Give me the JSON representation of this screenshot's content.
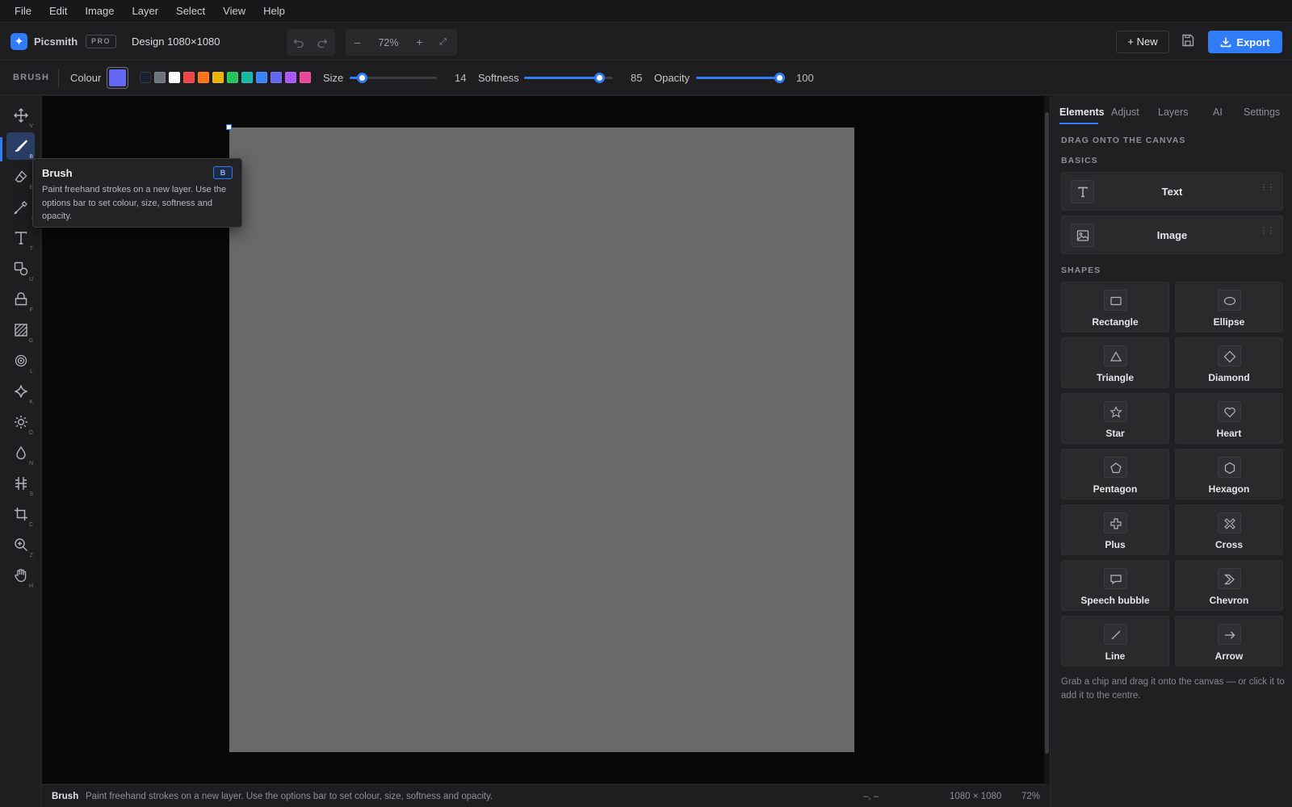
{
  "menu": [
    "File",
    "Edit",
    "Image",
    "Layer",
    "Select",
    "View",
    "Help"
  ],
  "app": {
    "name": "Picsmith",
    "badge": "PRO",
    "document": "Design 1080×1080"
  },
  "history": {
    "undo_icon": "undo-icon",
    "redo_icon": "redo-icon"
  },
  "zoom": {
    "minus": "–",
    "value": "72%",
    "plus": "+",
    "fit": "⤢"
  },
  "actions": {
    "new_label": "+ New",
    "save_icon": "save-icon",
    "export_label": "Export"
  },
  "options": {
    "tool": "BRUSH",
    "colour_label": "Colour",
    "current_colour": "#6467f2",
    "swatches": [
      "#1b2030",
      "#6b7280",
      "#ffffff",
      "#ef4444",
      "#f97316",
      "#eab308",
      "#22c55e",
      "#14b8a6",
      "#3b82f6",
      "#6366f1",
      "#a855f7",
      "#ec4899"
    ],
    "size": {
      "label": "Size",
      "value": "14",
      "fraction": 0.14
    },
    "softness": {
      "label": "Softness",
      "value": "85",
      "fraction": 0.85
    },
    "opacity": {
      "label": "Opacity",
      "value": "100",
      "fraction": 1.0
    },
    "accent": "#2f7cf6"
  },
  "tools": [
    {
      "name": "move-icon",
      "key": "V"
    },
    {
      "name": "brush-icon",
      "key": "B",
      "active": true
    },
    {
      "name": "eraser-icon",
      "key": "E"
    },
    {
      "name": "eyedropper-icon",
      "key": "I"
    },
    {
      "name": "text-icon",
      "key": "T"
    },
    {
      "name": "shapes-icon",
      "key": "U"
    },
    {
      "name": "fill-icon",
      "key": "F"
    },
    {
      "name": "gradient-icon",
      "key": "G"
    },
    {
      "name": "blur-icon",
      "key": "L"
    },
    {
      "name": "sparkle-icon",
      "key": "K"
    },
    {
      "name": "dodge-icon",
      "key": "O"
    },
    {
      "name": "smudge-icon",
      "key": "N"
    },
    {
      "name": "sharpen-icon",
      "key": "S"
    },
    {
      "name": "crop-icon",
      "key": "C"
    },
    {
      "name": "zoom-icon",
      "key": "Z"
    },
    {
      "name": "hand-icon",
      "key": "H"
    }
  ],
  "tooltip": {
    "title": "Brush",
    "key": "B",
    "description": "Paint freehand strokes on a new layer. Use the options bar to set colour, size, softness and opacity."
  },
  "status": {
    "tool": "Brush",
    "message": "Paint freehand strokes on a new layer. Use the options bar to set colour, size, softness and opacity.",
    "cursor": "–, –",
    "dimensions": "1080 × 1080",
    "zoom": "72%"
  },
  "panel": {
    "tabs": [
      "Elements",
      "Adjust",
      "Layers",
      "AI",
      "Settings"
    ],
    "heading": "DRAG ONTO THE CANVAS",
    "basics_label": "BASICS",
    "basics": [
      {
        "label": "Text",
        "icon": "text-icon"
      },
      {
        "label": "Image",
        "icon": "image-icon"
      }
    ],
    "shapes_label": "SHAPES",
    "shapes": [
      {
        "label": "Rectangle",
        "icon": "rectangle-icon"
      },
      {
        "label": "Ellipse",
        "icon": "ellipse-icon"
      },
      {
        "label": "Triangle",
        "icon": "triangle-icon"
      },
      {
        "label": "Diamond",
        "icon": "diamond-icon"
      },
      {
        "label": "Star",
        "icon": "star-icon"
      },
      {
        "label": "Heart",
        "icon": "heart-icon"
      },
      {
        "label": "Pentagon",
        "icon": "pentagon-icon"
      },
      {
        "label": "Hexagon",
        "icon": "hexagon-icon"
      },
      {
        "label": "Plus",
        "icon": "plus-icon"
      },
      {
        "label": "Cross",
        "icon": "cross-icon"
      },
      {
        "label": "Speech bubble",
        "icon": "speech-bubble-icon"
      },
      {
        "label": "Chevron",
        "icon": "chevron-icon"
      },
      {
        "label": "Line",
        "icon": "line-icon"
      },
      {
        "label": "Arrow",
        "icon": "arrow-icon"
      }
    ],
    "hint": "Grab a chip and drag it onto the canvas — or click it to add it to the centre."
  }
}
